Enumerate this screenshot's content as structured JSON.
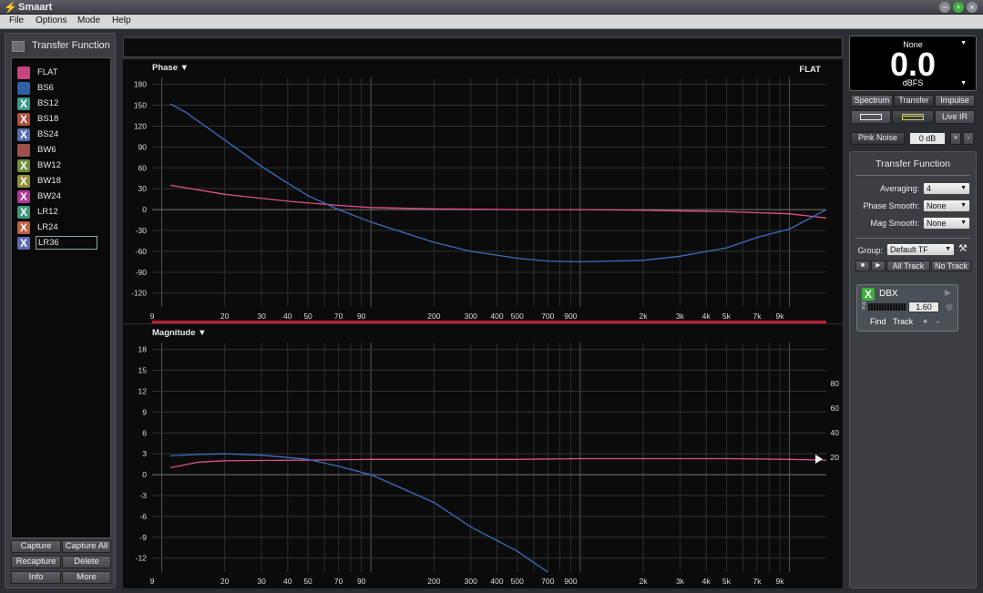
{
  "window": {
    "title": "Smaart"
  },
  "menu": [
    "File",
    "Options",
    "Mode",
    "Help"
  ],
  "left_panel": {
    "header": "Transfer Function",
    "traces": [
      {
        "name": "FLAT",
        "mark": "",
        "color": "#c8457f",
        "selected": false
      },
      {
        "name": "BS6",
        "mark": "",
        "color": "#2f5fa8",
        "selected": false
      },
      {
        "name": "BS12",
        "mark": "X",
        "color": "#3a9a8a",
        "selected": false
      },
      {
        "name": "BS18",
        "mark": "X",
        "color": "#b0503c",
        "selected": false
      },
      {
        "name": "BS24",
        "mark": "X",
        "color": "#4f6fb0",
        "selected": false
      },
      {
        "name": "BW6",
        "mark": "",
        "color": "#a0504a",
        "selected": false
      },
      {
        "name": "BW12",
        "mark": "X",
        "color": "#6f8f3a",
        "selected": false
      },
      {
        "name": "BW18",
        "mark": "X",
        "color": "#8f8f3a",
        "selected": false
      },
      {
        "name": "BW24",
        "mark": "X",
        "color": "#b0349a",
        "selected": false
      },
      {
        "name": "LR12",
        "mark": "X",
        "color": "#3a9a7a",
        "selected": false
      },
      {
        "name": "LR24",
        "mark": "X",
        "color": "#c0603c",
        "selected": false
      },
      {
        "name": "LR36",
        "mark": "X",
        "color": "#5a6ab0",
        "selected": true
      }
    ],
    "buttons": {
      "capture": "Capture",
      "capture_all": "Capture All",
      "recapture": "Recapture",
      "delete": "Delete",
      "info": "Info",
      "more": "More"
    }
  },
  "phase_plot": {
    "title": "Phase ▼",
    "tag": "FLAT",
    "y_ticks": [
      "180",
      "150",
      "120",
      "90",
      "60",
      "30",
      "0",
      "-30",
      "-60",
      "-90",
      "-120"
    ],
    "x_ticks": [
      "9",
      "20",
      "30",
      "40",
      "50",
      "70",
      "90",
      "200",
      "300",
      "400",
      "500",
      "700",
      "900",
      "2k",
      "3k",
      "4k",
      "5k",
      "7k",
      "9k"
    ]
  },
  "mag_plot": {
    "title": "Magnitude ▼",
    "y_ticks": [
      "18",
      "15",
      "12",
      "9",
      "6",
      "3",
      "0",
      "-3",
      "-6",
      "-9",
      "-12"
    ],
    "y2_ticks": [
      "80",
      "60",
      "40",
      "20"
    ],
    "x_ticks": [
      "9",
      "20",
      "30",
      "40",
      "50",
      "70",
      "90",
      "200",
      "300",
      "400",
      "500",
      "700",
      "900",
      "2k",
      "3k",
      "4k",
      "5k",
      "7k",
      "9k"
    ]
  },
  "chart_data": [
    {
      "type": "line",
      "title": "Phase",
      "xlabel": "",
      "ylabel": "",
      "x_scale": "log",
      "xlim": [
        9,
        15000
      ],
      "ylim": [
        -140,
        190
      ],
      "grid": true,
      "series": [
        {
          "name": "FLAT",
          "color": "#e0508a",
          "x": [
            11,
            20,
            40,
            70,
            100,
            200,
            500,
            1000,
            2000,
            5000,
            10000,
            15000
          ],
          "y": [
            35,
            22,
            12,
            6,
            3,
            1,
            0,
            0,
            -1,
            -3,
            -6,
            -12
          ]
        },
        {
          "name": "BS6",
          "color": "#3a6fc0",
          "x": [
            11,
            13,
            20,
            30,
            40,
            50,
            70,
            100,
            200,
            300,
            500,
            700,
            1000,
            2000,
            3000,
            5000,
            7000,
            10000,
            15000
          ],
          "y": [
            152,
            140,
            100,
            62,
            38,
            20,
            0,
            -18,
            -47,
            -60,
            -70,
            -74,
            -75,
            -73,
            -67,
            -55,
            -40,
            -28,
            0
          ]
        }
      ]
    },
    {
      "type": "line",
      "title": "Magnitude",
      "xlabel": "",
      "ylabel": "",
      "x_scale": "log",
      "xlim": [
        9,
        15000
      ],
      "ylim": [
        -14,
        19
      ],
      "grid": true,
      "series": [
        {
          "name": "FLAT",
          "color": "#e0508a",
          "x": [
            11,
            15,
            20,
            50,
            100,
            500,
            1000,
            5000,
            10000,
            15000
          ],
          "y": [
            1,
            1.8,
            2,
            2.1,
            2.2,
            2.2,
            2.3,
            2.3,
            2.2,
            2.1
          ]
        },
        {
          "name": "BS6",
          "color": "#3a6fc0",
          "x": [
            11,
            15,
            20,
            30,
            50,
            70,
            100,
            200,
            300,
            500,
            700
          ],
          "y": [
            2.7,
            2.9,
            3,
            2.8,
            2.2,
            1.2,
            0,
            -4,
            -7.5,
            -11,
            -14
          ]
        }
      ]
    }
  ],
  "meter": {
    "source": "None",
    "value": "0.0",
    "unit": "dBFS"
  },
  "right_panel": {
    "mode_buttons": [
      "Spectrum",
      "Transfer",
      "Impulse"
    ],
    "live_ir": "Live IR",
    "pink_noise": "Pink Noise",
    "noise_level": "0 dB",
    "plus": "+",
    "minus": "-",
    "tf_header": "Transfer Function",
    "averaging_label": "Averaging:",
    "averaging_value": "4",
    "phase_smooth_label": "Phase Smooth:",
    "phase_smooth_value": "None",
    "mag_smooth_label": "Mag Smooth:",
    "mag_smooth_value": "None",
    "group_label": "Group:",
    "group_value": "Default TF",
    "all_track": "All Track",
    "no_track": "No Track",
    "dbx": {
      "name": "DBX",
      "delay": "1.60",
      "find": "Find",
      "track": "Track",
      "plus": "+",
      "minus": "-"
    }
  }
}
